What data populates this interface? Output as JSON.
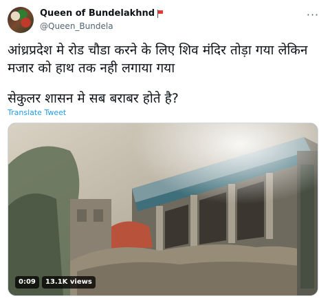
{
  "tweet": {
    "author": {
      "display_name": "Queen of Bundelakhnd",
      "handle": "@Queen_Bundela"
    },
    "more_icon": "ellipsis-icon",
    "text_lines": [
      "आंध्रप्रदेश मे रोड चौडा करने के लिए शिव मंदिर तोड़ा गया लेकिन मजार को हाथ तक नही लगाया गया",
      "सेकुलर शासन मे सब बराबर होते है?"
    ],
    "translate_label": "Translate Tweet",
    "media": {
      "duration": "0:09",
      "views": "13.1K views"
    }
  },
  "colors": {
    "text": "#0f1419",
    "secondary": "#536471",
    "link": "#1d9bf0",
    "flag": "#e53935"
  }
}
